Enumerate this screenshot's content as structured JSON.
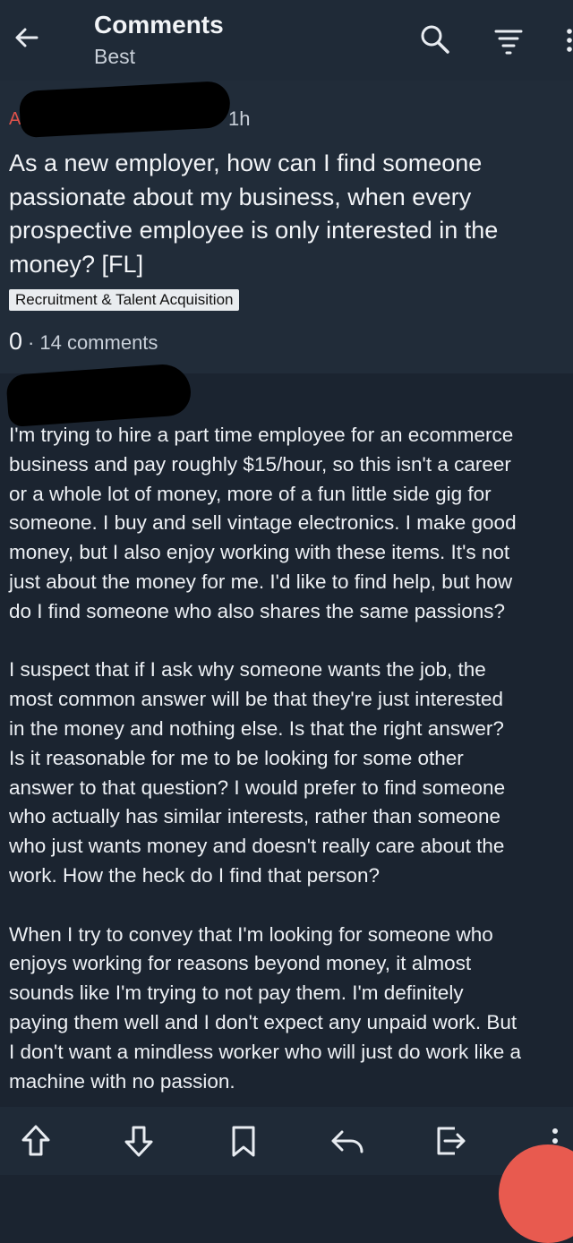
{
  "header": {
    "title": "Comments",
    "sort_label": "Best",
    "icons": [
      "back-arrow-icon",
      "search-icon",
      "sort-icon",
      "more-vertical-icon"
    ]
  },
  "post": {
    "author_initial": "A",
    "time": "1h",
    "title": "As a new employer, how can I find someone passionate about my business, when every prospective employee is only interested in the money? [FL]",
    "flair": "Recruitment & Talent Acquisition",
    "score": "0",
    "separator": "·",
    "comments": "14 comments"
  },
  "body": {
    "paragraphs": [
      {
        "lines": [
          "I'm trying to hire a part time employee for an ecommerce",
          "business and pay roughly $15/hour, so this isn't a career",
          "or a whole lot of money, more of a fun little side gig for",
          "someone. I buy and sell vintage electronics. I make good",
          "money, but I also enjoy working with these items. It's not",
          "just about the money for me. I'd like to find help, but how",
          "do I find someone who also shares the same passions?"
        ]
      },
      {
        "lines": [
          "I suspect that if I ask why someone wants the job, the",
          "most common answer will be that they're just interested",
          "in the money and nothing else. Is that the right answer?",
          "Is it reasonable for me to be looking for some other",
          "answer to that question? I would prefer to find someone",
          "who actually has similar interests, rather than someone",
          "who just wants money and doesn't really care about the",
          "work. How the heck do I find that person?"
        ]
      },
      {
        "lines": [
          "When I try to convey that I'm looking for someone who",
          "enjoys working for reasons beyond money, it almost",
          "sounds like I'm trying to not pay them. I'm definitely",
          "paying them well and I don't expect any unpaid work. But",
          "I don't want a mindless worker who will just do work like a",
          "machine with no passion."
        ]
      }
    ]
  },
  "bottom_bar": {
    "icons": [
      "upvote-icon",
      "downvote-icon",
      "bookmark-icon",
      "reply-icon",
      "share-exit-icon"
    ]
  },
  "colors": {
    "background": "#1b2430",
    "bar": "#1f2a37",
    "accent": "#e85a4f",
    "flair_bg": "#e9ecef"
  }
}
